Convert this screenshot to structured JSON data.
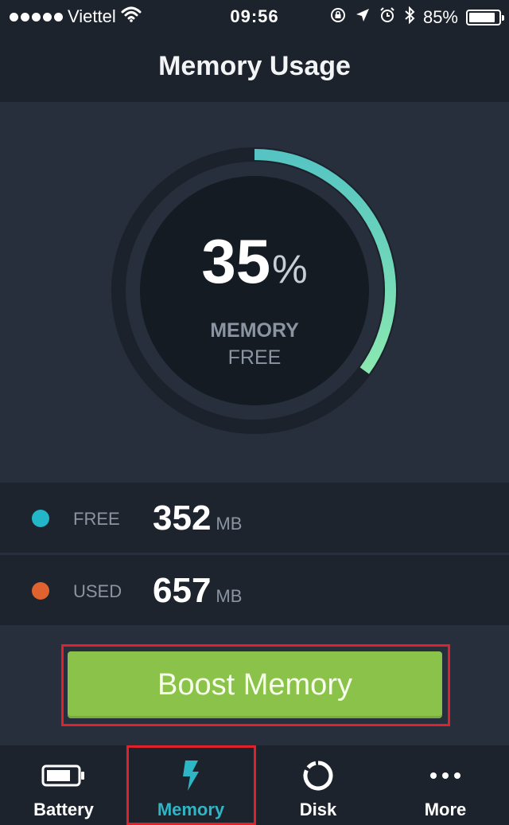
{
  "status_bar": {
    "carrier": "Viettel",
    "time": "09:56",
    "battery_percent": "85%"
  },
  "header": {
    "title": "Memory Usage"
  },
  "gauge": {
    "value": "35",
    "unit": "%",
    "label_top": "MEMORY",
    "label_bottom": "FREE",
    "fraction": 0.35,
    "colors": {
      "start": "#55c4c3",
      "end": "#8ae8b0",
      "track": "#1c222b",
      "inner": "#141b23"
    }
  },
  "stats": {
    "free": {
      "label": "FREE",
      "value": "352",
      "unit": "MB",
      "color": "#22b6c8"
    },
    "used": {
      "label": "USED",
      "value": "657",
      "unit": "MB",
      "color": "#e0622e"
    }
  },
  "boost_button": {
    "label": "Boost Memory",
    "color": "#8bc34a"
  },
  "tabs": [
    {
      "label": "Battery",
      "icon": "battery-icon"
    },
    {
      "label": "Memory",
      "icon": "lightning-icon",
      "active": true
    },
    {
      "label": "Disk",
      "icon": "disk-icon"
    },
    {
      "label": "More",
      "icon": "more-dots-icon"
    }
  ]
}
